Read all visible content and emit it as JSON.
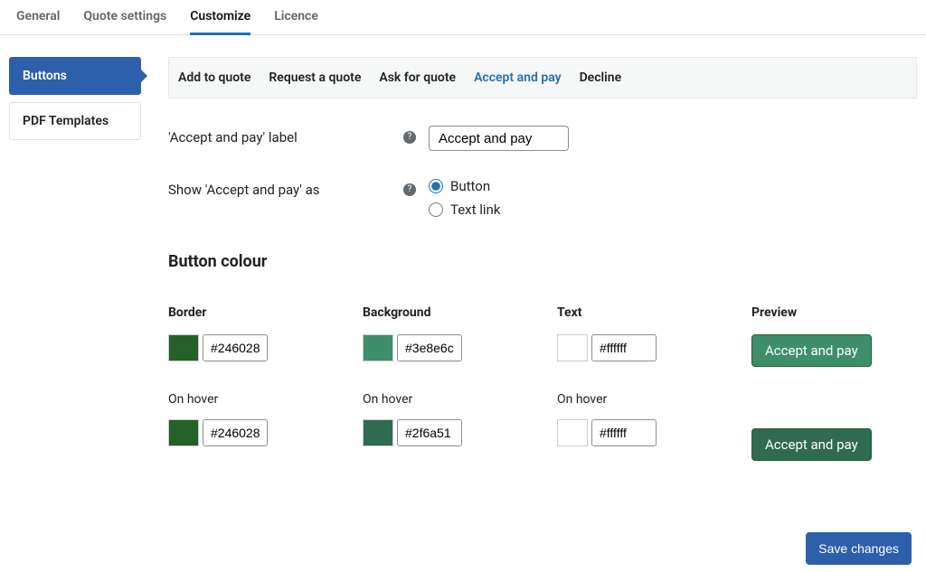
{
  "top_tabs": {
    "general": "General",
    "quote_settings": "Quote settings",
    "customize": "Customize",
    "licence": "Licence"
  },
  "sidebar": {
    "buttons": "Buttons",
    "pdf_templates": "PDF Templates"
  },
  "subtabs": {
    "add_to_quote": "Add to quote",
    "request_a_quote": "Request a quote",
    "ask_for_quote": "Ask for quote",
    "accept_and_pay": "Accept and pay",
    "decline": "Decline"
  },
  "form": {
    "label_title": "'Accept and pay' label",
    "label_value": "Accept and pay",
    "show_as_title": "Show 'Accept and pay' as",
    "show_as_options": {
      "button": "Button",
      "text_link": "Text link"
    }
  },
  "colour": {
    "heading": "Button colour",
    "cols": {
      "border": "Border",
      "background": "Background",
      "text": "Text",
      "preview": "Preview"
    },
    "on_hover_label": "On hover",
    "border": {
      "normal": "#246028",
      "hover": "#246028"
    },
    "background": {
      "normal": "#3e8e6c",
      "hover": "#2f6a51"
    },
    "text": {
      "normal": "#ffffff",
      "hover": "#ffffff"
    },
    "preview_label": "Accept and pay"
  },
  "save_label": "Save changes"
}
